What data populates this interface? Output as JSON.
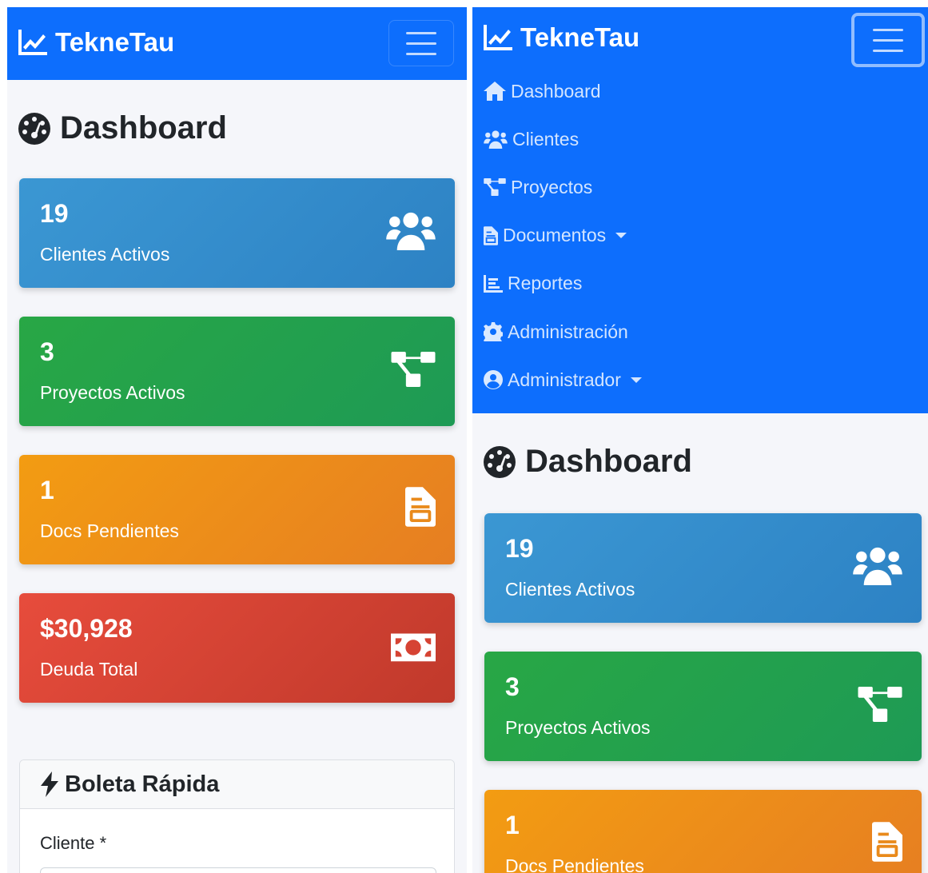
{
  "brand": {
    "name": "TekneTau"
  },
  "nav": {
    "items": [
      {
        "label": "Dashboard",
        "icon": "home-icon"
      },
      {
        "label": "Clientes",
        "icon": "users-icon"
      },
      {
        "label": "Proyectos",
        "icon": "project-diagram-icon"
      },
      {
        "label": "Documentos",
        "icon": "document-icon",
        "dropdown": true
      },
      {
        "label": "Reportes",
        "icon": "report-icon"
      },
      {
        "label": "Administración",
        "icon": "gear-icon"
      },
      {
        "label": "Administrador",
        "icon": "user-circle-icon",
        "dropdown": true
      }
    ]
  },
  "page": {
    "title": "Dashboard"
  },
  "stats": [
    {
      "value": "19",
      "label": "Clientes Activos",
      "icon": "users-icon",
      "color": "#3498db"
    },
    {
      "value": "3",
      "label": "Proyectos Activos",
      "icon": "project-diagram-icon",
      "color": "#28a745"
    },
    {
      "value": "1",
      "label": "Docs Pendientes",
      "icon": "document-icon",
      "color": "#f39c12"
    },
    {
      "value": "$30,928",
      "label": "Deuda Total",
      "icon": "money-bill-icon",
      "color": "#e74c3c"
    }
  ],
  "quick_form": {
    "title": "Boleta Rápida",
    "client_label": "Cliente *"
  },
  "colors": {
    "navbar": "#0d6efd",
    "background": "#f5f6fa"
  }
}
